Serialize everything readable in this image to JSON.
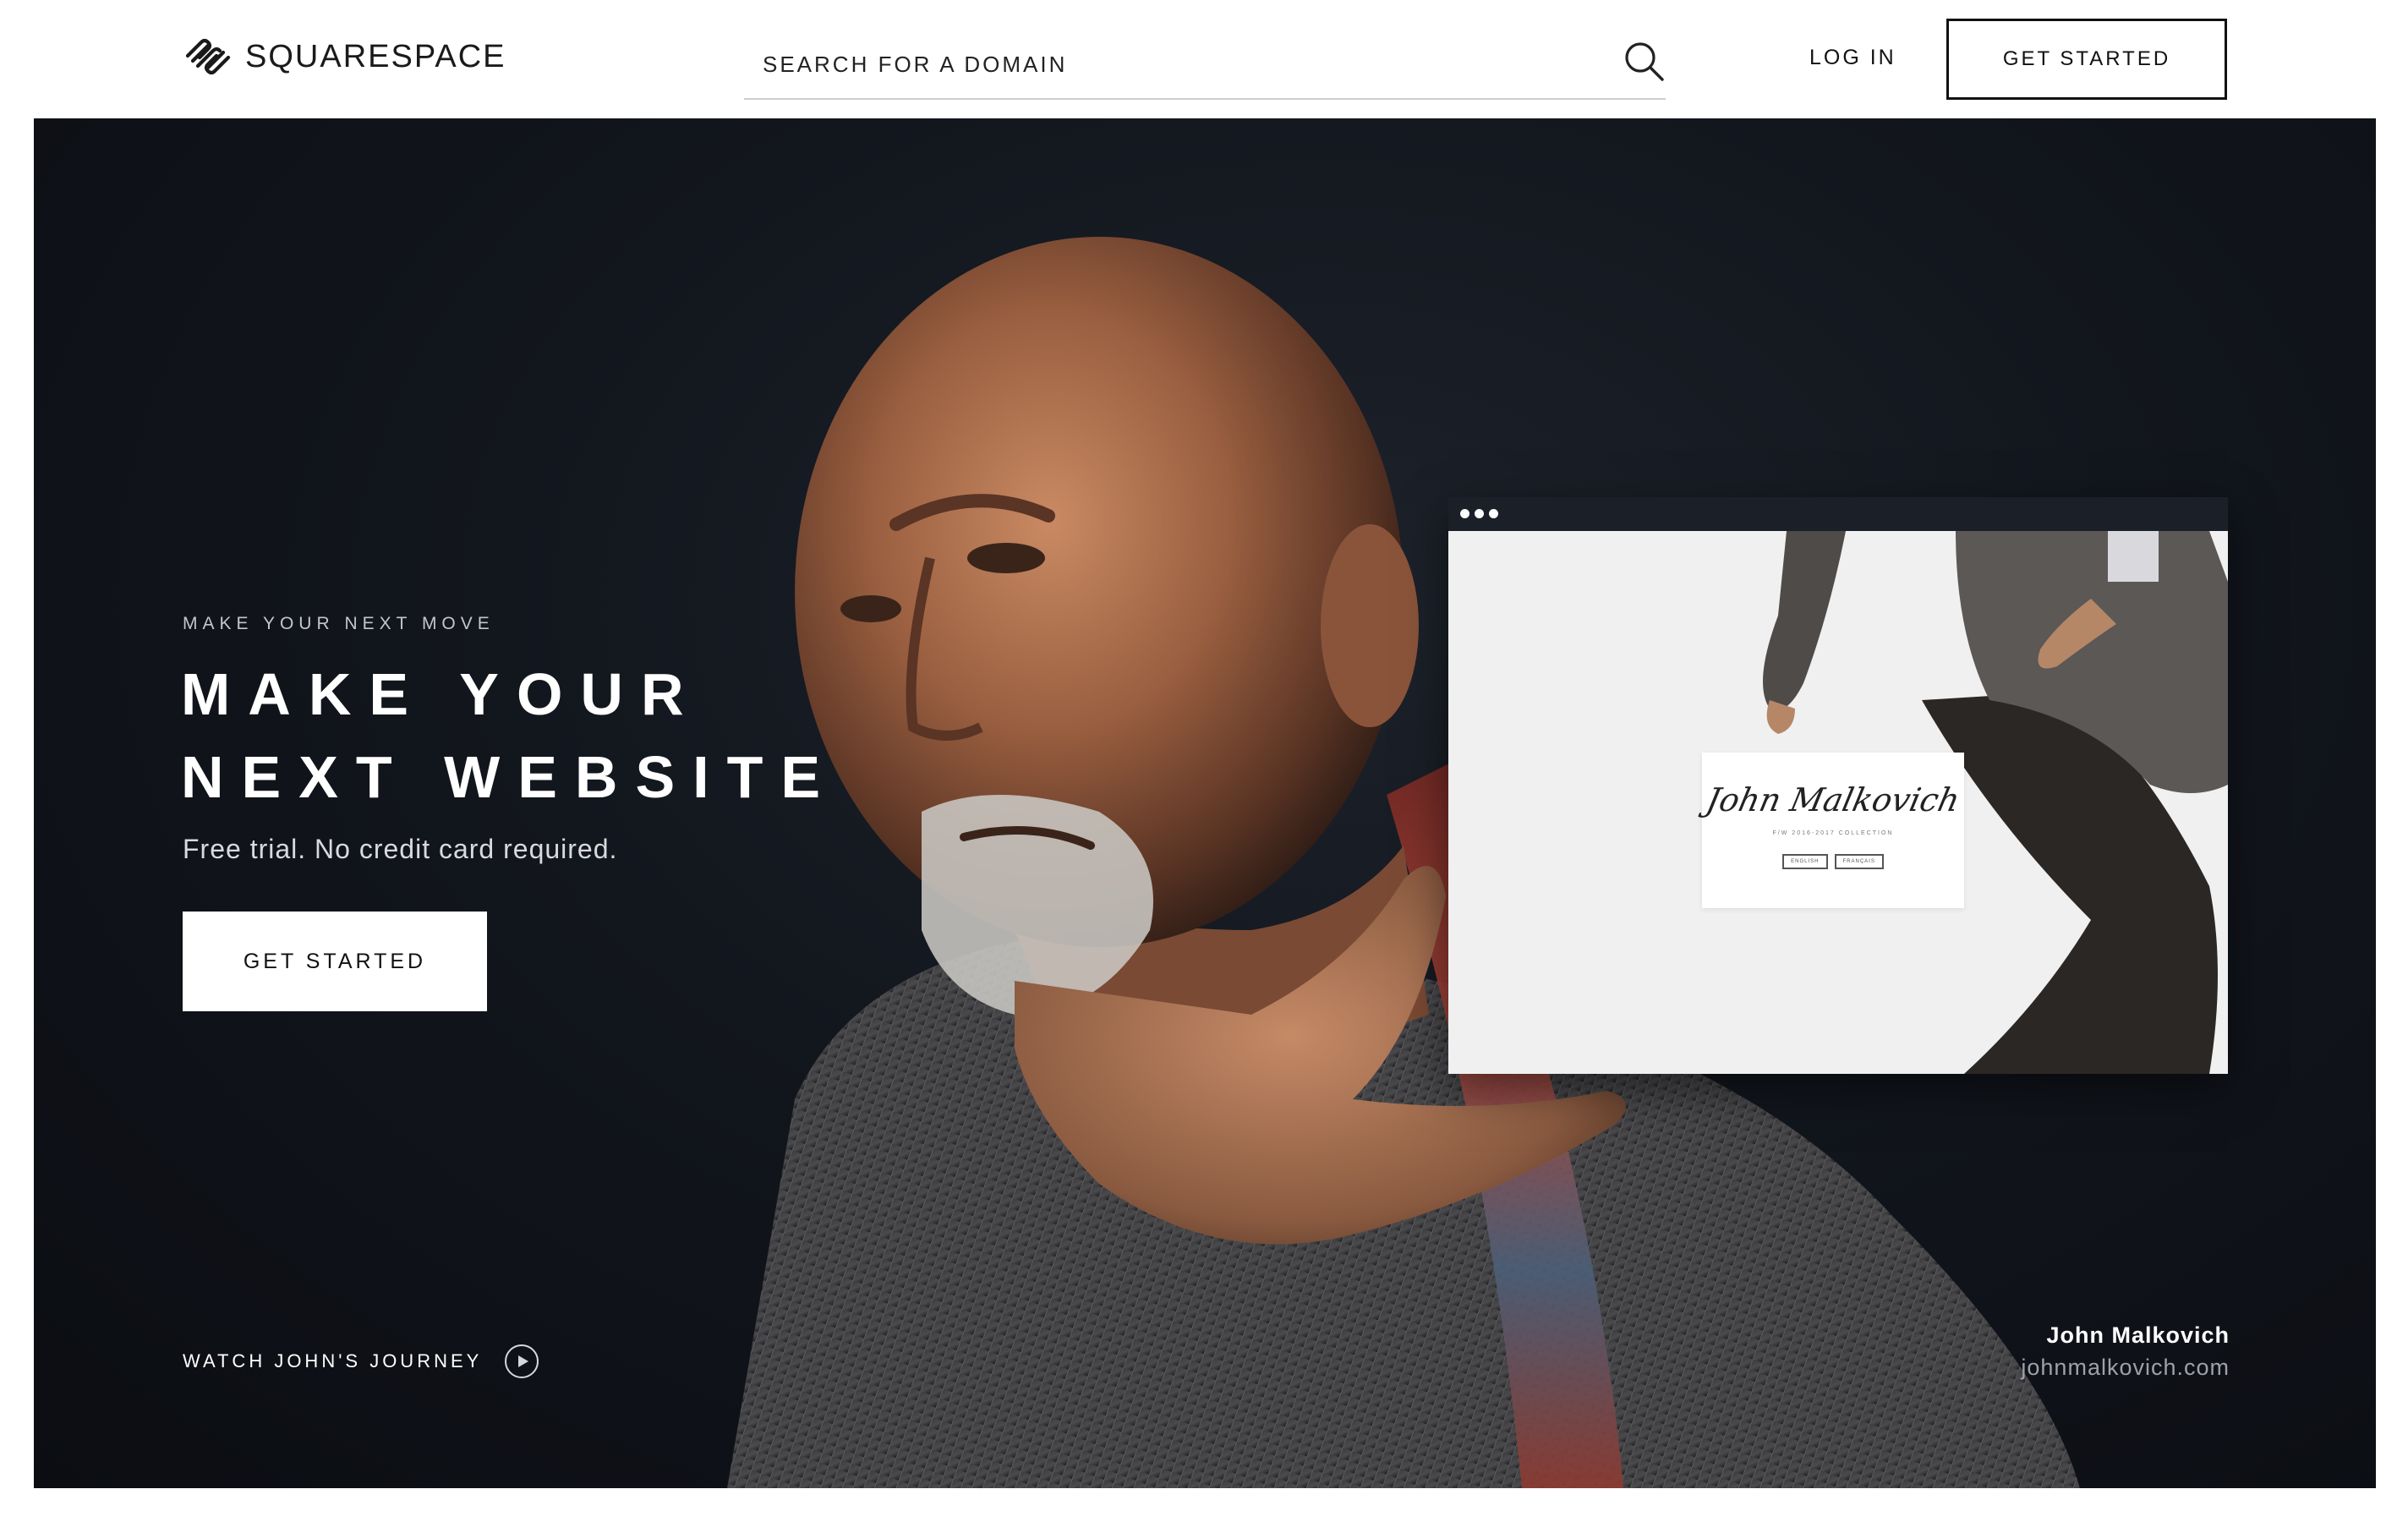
{
  "header": {
    "logo_text": "SQUARESPACE",
    "search_placeholder": "SEARCH FOR A DOMAIN",
    "login_label": "LOG IN",
    "cta_label": "GET STARTED"
  },
  "hero": {
    "eyebrow": "MAKE YOUR NEXT MOVE",
    "headline_line1": "MAKE YOUR",
    "headline_line2": "NEXT WEBSITE",
    "subtext": "Free trial. No credit card required.",
    "cta_label": "GET STARTED",
    "video_link": "WATCH JOHN'S JOURNEY",
    "credit_name": "John Malkovich",
    "credit_url": "johnmalkovich.com"
  },
  "preview": {
    "signature": "John Malkovich",
    "caption": "F/W 2016-2017 COLLECTION",
    "buttons": [
      "ENGLISH",
      "FRANÇAIS"
    ]
  },
  "icons": {
    "logo": "squarespace-logo-icon",
    "search": "search-icon",
    "play": "play-icon"
  },
  "colors": {
    "hero_background": "#12161d",
    "primary_text": "#111111",
    "hero_text": "#ffffff",
    "preview_background": "#f0f0f0",
    "preview_toolbar": "#1b1f27"
  }
}
